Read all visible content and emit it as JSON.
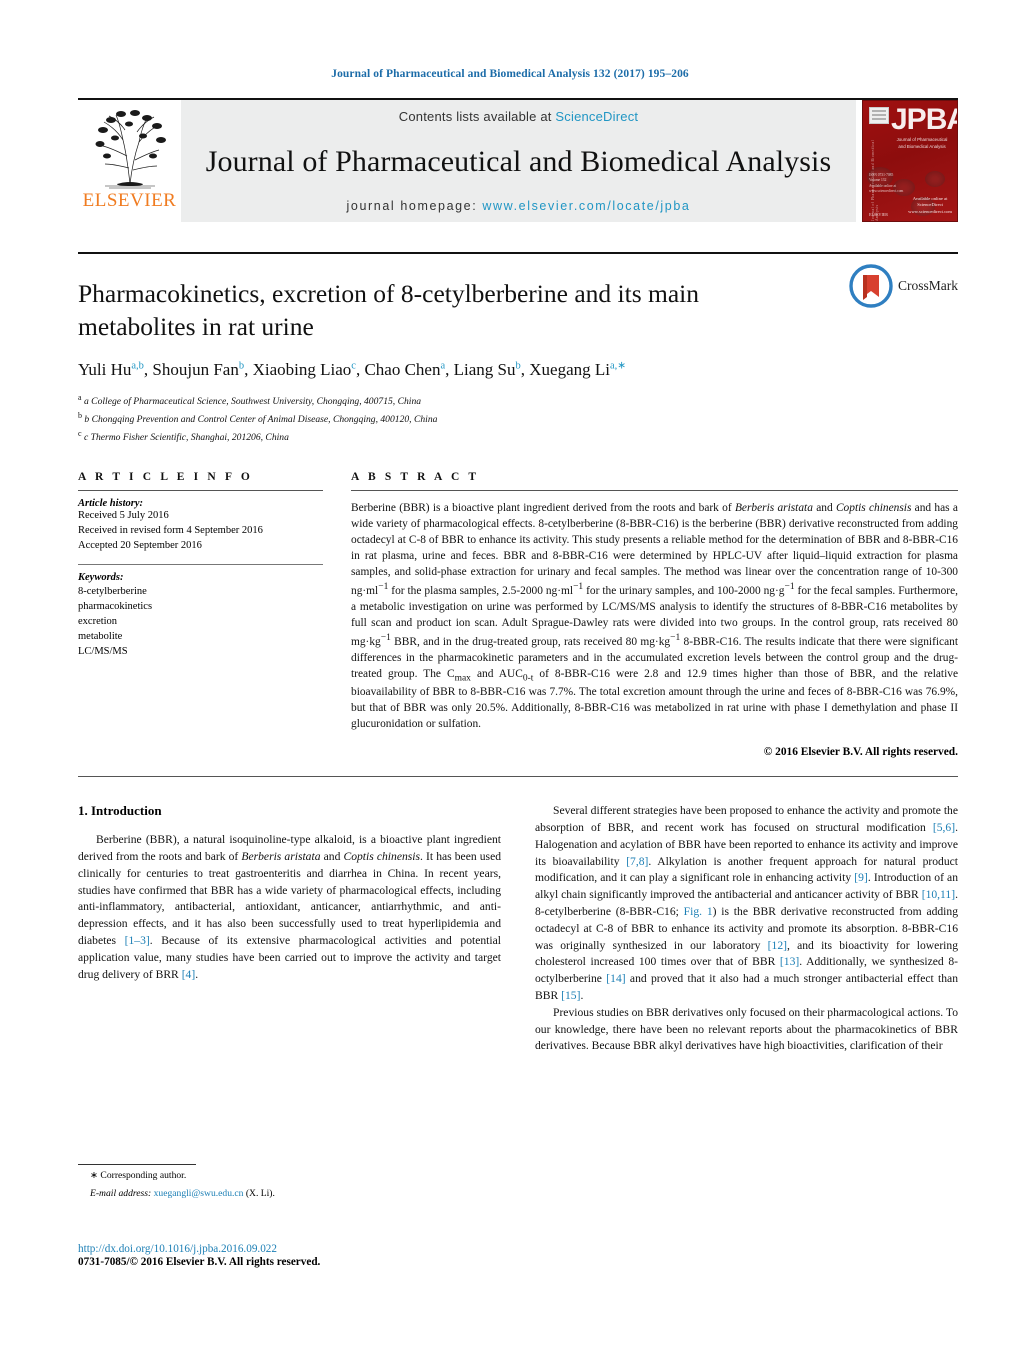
{
  "running_head": "Journal of Pharmaceutical and Biomedical Analysis 132 (2017) 195–206",
  "masthead": {
    "contents_prefix": "Contents lists available at ",
    "sciencedirect": "ScienceDirect",
    "journal_title": "Journal of Pharmaceutical and Biomedical Analysis",
    "homepage_prefix": "journal homepage: ",
    "homepage_url": "www.elsevier.com/locate/jpba",
    "publisher": "ELSEVIER",
    "cover": {
      "acronym": "JPBA",
      "subtitle": "Journal of Pharmaceutical and Biomedical Analysis",
      "spine": "Journal of Pharmaceutical and Biomedical Analysis",
      "footer": "ISSN 0731-7085\nVolume 132\nAvailable online at\nwww.sciencedirect.com",
      "bottom": "ELSEVIER",
      "logo_bl": "Available online at\nScienceDirect\nwww.sciencedirect.com"
    }
  },
  "article": {
    "title": "Pharmacokinetics, excretion of 8-cetylberberine and its main metabolites in rat urine",
    "authors_html": "Yuli Hu<sup>a,b</sup>, Shoujun Fan<sup>b</sup>, Xiaobing Liao<sup>c</sup>, Chao Chen<sup>a</sup>, Liang Su<sup>b</sup>, Xuegang Li<sup>a,∗</sup>",
    "affiliations": [
      "a College of Pharmaceutical Science, Southwest University, Chongqing, 400715, China",
      "b Chongqing Prevention and Control Center of Animal Disease, Chongqing, 400120, China",
      "c Thermo Fisher Scientific, Shanghai, 201206, China"
    ],
    "crossmark_label": "CrossMark"
  },
  "info": {
    "heading": "A R T I C L E   I N F O",
    "history_label": "Article history:",
    "history": [
      "Received 5 July 2016",
      "Received in revised form 4 September 2016",
      "Accepted 20 September 2016"
    ],
    "keywords_label": "Keywords:",
    "keywords": [
      "8-cetylberberine",
      "pharmacokinetics",
      "excretion",
      "metabolite",
      "LC/MS/MS"
    ]
  },
  "abstract": {
    "heading": "A B S T R A C T",
    "text_html": "Berberine (BBR) is a bioactive plant ingredient derived from the roots and bark of <i>Berberis aristata</i> and <i>Coptis chinensis</i> and has a wide variety of pharmacological effects. 8-cetylberberine (8-BBR-C16) is the berberine (BBR) derivative reconstructed from adding octadecyl at C-8 of BBR to enhance its activity. This study presents a reliable method for the determination of BBR and 8-BBR-C16 in rat plasma, urine and feces. BBR and 8-BBR-C16 were determined by HPLC-UV after liquid–liquid extraction for plasma samples, and solid-phase extraction for urinary and fecal samples. The method was linear over the concentration range of 10-300 ng&middot;ml<sup>−1</sup> for the plasma samples, 2.5-2000 ng&middot;ml<sup>−1</sup> for the urinary samples, and 100-2000 ng&middot;g<sup>−1</sup> for the fecal samples. Furthermore, a metabolic investigation on urine was performed by LC/MS/MS analysis to identify the structures of 8-BBR-C16 metabolites by full scan and product ion scan. Adult Sprague-Dawley rats were divided into two groups. In the control group, rats received 80 mg&middot;kg<sup>−1</sup> BBR, and in the drug-treated group, rats received 80 mg&middot;kg<sup>−1</sup> 8-BBR-C16. The results indicate that there were significant differences in the pharmacokinetic parameters and in the accumulated excretion levels between the control group and the drug-treated group. The C<sub>max</sub> and AUC<sub>0-t</sub> of 8-BBR-C16 were 2.8 and 12.9 times higher than those of BBR, and the relative bioavailability of BBR to 8-BBR-C16 was 7.7%. The total excretion amount through the urine and feces of 8-BBR-C16 was 76.9%, but that of BBR was only 20.5%. Additionally, 8-BBR-C16 was metabolized in rat urine with phase I demethylation and phase II glucuronidation or sulfation.",
    "copyright": "© 2016 Elsevier B.V. All rights reserved."
  },
  "introduction": {
    "heading": "1.  Introduction",
    "left_paragraphs_html": [
      "Berberine (BBR), a natural isoquinoline-type alkaloid, is a bioactive plant ingredient derived from the roots and bark of <i>Berberis aristata</i> and <i>Coptis chinensis</i>. It has been used clinically for centuries to treat gastroenteritis and diarrhea in China. In recent years, studies have confirmed that BBR has a wide variety of pharmacological effects, including anti-inflammatory, antibacterial, antioxidant, anticancer, antiarrhythmic, and anti-depression effects, and it has also been successfully used to treat hyperlipidemia and diabetes <span class=\"ref\">[1–3]</span>. Because of its extensive pharmacological activities and potential application value, many studies have been carried out to improve the activity and target drug delivery of BRR <span class=\"ref\">[4]</span>."
    ],
    "right_paragraphs_html": [
      "Several different strategies have been proposed to enhance the activity and promote the absorption of BBR, and recent work has focused on structural modification <span class=\"ref\">[5,6]</span>. Halogenation and acylation of BBR have been reported to enhance its activity and improve its bioavailability <span class=\"ref\">[7,8]</span>. Alkylation is another frequent approach for natural product modification, and it can play a significant role in enhancing activity <span class=\"ref\">[9]</span>. Introduction of an alkyl chain significantly improved the antibacterial and anticancer activity of BBR <span class=\"ref\">[10,11]</span>. 8-cetylberberine (8-BBR-C16; <span class=\"ref\">Fig. 1</span>) is the BBR derivative reconstructed from adding octadecyl at C-8 of BBR to enhance its activity and promote its absorption. 8-BBR-C16 was originally synthesized in our laboratory <span class=\"ref\">[12]</span>, and its bioactivity for lowering cholesterol increased 100 times over that of BBR <span class=\"ref\">[13]</span>. Additionally, we synthesized 8-octylberberine <span class=\"ref\">[14]</span> and proved that it also had a much stronger antibacterial effect than BBR <span class=\"ref\">[15]</span>.",
      "Previous studies on BBR derivatives only focused on their pharmacological actions. To our knowledge, there have been no relevant reports about the pharmacokinetics of BBR derivatives. Because BBR alkyl derivatives have high bioactivities, clarification of their"
    ]
  },
  "footnote": {
    "corresponding": "∗  Corresponding author.",
    "email_label": "E-mail address:",
    "email": "xuegangli@swu.edu.cn",
    "email_suffix": "(X. Li)."
  },
  "bottom": {
    "doi": "http://dx.doi.org/10.1016/j.jpba.2016.09.022",
    "issn": "0731-7085/© 2016 Elsevier B.V. All rights reserved."
  },
  "colors": {
    "link_blue": "#1c7fb5",
    "sd_blue": "#2196c4",
    "elsevier_orange": "#f07c21",
    "cover_red": "#a01010"
  }
}
